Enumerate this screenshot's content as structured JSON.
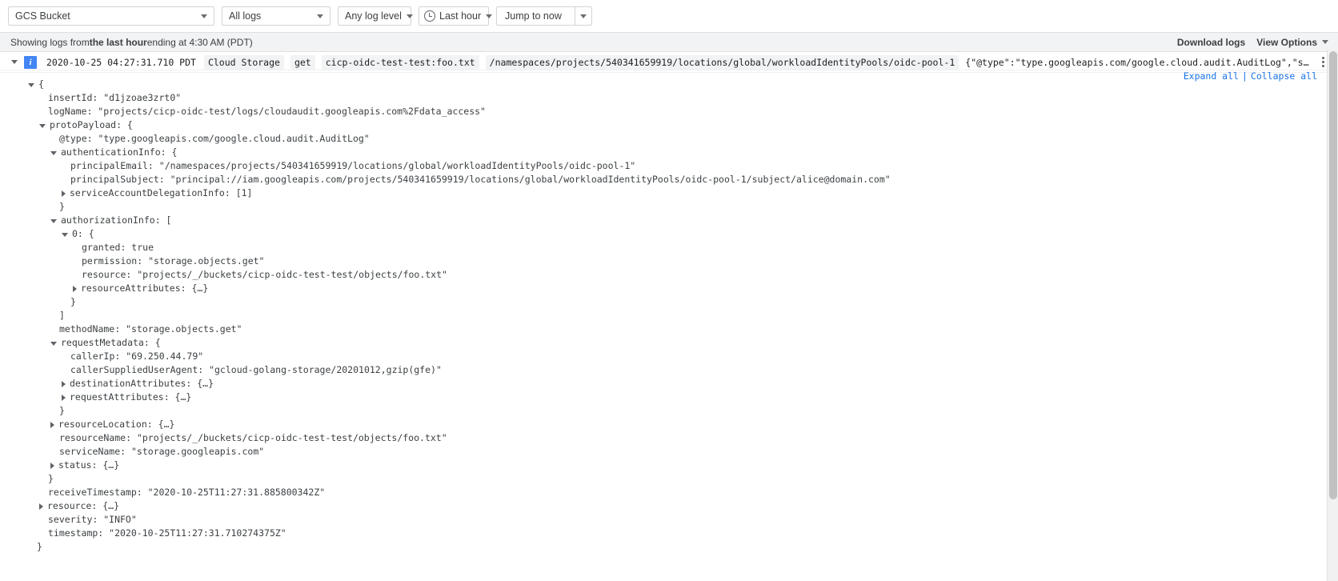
{
  "toolbar": {
    "resource_selector": {
      "label": "GCS Bucket",
      "icon": "chevron-down-icon"
    },
    "logs_selector": {
      "label": "All logs",
      "icon": "chevron-down-icon"
    },
    "level_selector": {
      "label": "Any log level",
      "icon": "chevron-down-icon"
    },
    "time_selector": {
      "label": "Last hour",
      "icon": "clock-icon",
      "caret": "chevron-down-icon"
    },
    "jump_button": {
      "label": "Jump to now",
      "caret": "chevron-down-icon"
    }
  },
  "statusbar": {
    "prefix": "Showing logs from ",
    "range": "the last hour",
    "suffix": " ending at 4:30 AM (PDT)",
    "download_logs": "Download logs",
    "view_options": "View Options"
  },
  "entry": {
    "severity_letter": "i",
    "severity": "INFO",
    "timestamp": "2020-10-25 04:27:31.710 PDT",
    "service_chip": "Cloud Storage",
    "method_chip": "get",
    "resource_chip": "cicp-oidc-test-test:foo.txt",
    "principal_chip": "/namespaces/projects/540341659919/locations/global/workloadIdentityPools/oidc-pool-1",
    "summary": "{\"@type\":\"type.googleapis.com/google.cloud.audit.AuditLog\",\"status\":{},\"authenticationInfo\":…",
    "kebab": "more-options-icon"
  },
  "tree_actions": {
    "expand_all": "Expand all",
    "separator": "|",
    "collapse_all": "Collapse all"
  },
  "colors": {
    "accent": "#1a73e8",
    "severity_info": "#4285f4",
    "chip_bg": "#f1f3f4",
    "statusbar_bg": "#f1f3f4"
  },
  "json_lines": [
    {
      "indent": 0,
      "arrow": "open",
      "text": "{"
    },
    {
      "indent": 1,
      "arrow": "none",
      "text": "insertId: \"d1jzoae3zrt0\""
    },
    {
      "indent": 1,
      "arrow": "none",
      "text": "logName: \"projects/cicp-oidc-test/logs/cloudaudit.googleapis.com%2Fdata_access\""
    },
    {
      "indent": 1,
      "arrow": "open",
      "text": "protoPayload: {"
    },
    {
      "indent": 2,
      "arrow": "none",
      "text": "@type: \"type.googleapis.com/google.cloud.audit.AuditLog\""
    },
    {
      "indent": 2,
      "arrow": "open",
      "text": "authenticationInfo: {"
    },
    {
      "indent": 3,
      "arrow": "none",
      "text": "principalEmail: \"/namespaces/projects/540341659919/locations/global/workloadIdentityPools/oidc-pool-1\""
    },
    {
      "indent": 3,
      "arrow": "none",
      "text": "principalSubject: \"principal://iam.googleapis.com/projects/540341659919/locations/global/workloadIdentityPools/oidc-pool-1/subject/alice@domain.com\""
    },
    {
      "indent": 3,
      "arrow": "closed",
      "text": "serviceAccountDelegationInfo: [1]"
    },
    {
      "indent": 2,
      "arrow": "none",
      "text": "}"
    },
    {
      "indent": 2,
      "arrow": "open",
      "text": "authorizationInfo: ["
    },
    {
      "indent": 3,
      "arrow": "open",
      "text": "0: {"
    },
    {
      "indent": 4,
      "arrow": "none",
      "text": "granted: true"
    },
    {
      "indent": 4,
      "arrow": "none",
      "text": "permission: \"storage.objects.get\""
    },
    {
      "indent": 4,
      "arrow": "none",
      "text": "resource: \"projects/_/buckets/cicp-oidc-test-test/objects/foo.txt\""
    },
    {
      "indent": 4,
      "arrow": "closed",
      "text": "resourceAttributes: {…}"
    },
    {
      "indent": 3,
      "arrow": "none",
      "text": "}"
    },
    {
      "indent": 2,
      "arrow": "none",
      "text": "]"
    },
    {
      "indent": 2,
      "arrow": "none",
      "text": "methodName: \"storage.objects.get\""
    },
    {
      "indent": 2,
      "arrow": "open",
      "text": "requestMetadata: {"
    },
    {
      "indent": 3,
      "arrow": "none",
      "text": "callerIp: \"69.250.44.79\""
    },
    {
      "indent": 3,
      "arrow": "none",
      "text": "callerSuppliedUserAgent: \"gcloud-golang-storage/20201012,gzip(gfe)\""
    },
    {
      "indent": 3,
      "arrow": "closed",
      "text": "destinationAttributes: {…}"
    },
    {
      "indent": 3,
      "arrow": "closed",
      "text": "requestAttributes: {…}"
    },
    {
      "indent": 2,
      "arrow": "none",
      "text": "}"
    },
    {
      "indent": 2,
      "arrow": "closed",
      "text": "resourceLocation: {…}"
    },
    {
      "indent": 2,
      "arrow": "none",
      "text": "resourceName: \"projects/_/buckets/cicp-oidc-test-test/objects/foo.txt\""
    },
    {
      "indent": 2,
      "arrow": "none",
      "text": "serviceName: \"storage.googleapis.com\""
    },
    {
      "indent": 2,
      "arrow": "closed",
      "text": "status: {…}"
    },
    {
      "indent": 1,
      "arrow": "none",
      "text": "}"
    },
    {
      "indent": 1,
      "arrow": "none",
      "text": "receiveTimestamp: \"2020-10-25T11:27:31.885800342Z\""
    },
    {
      "indent": 1,
      "arrow": "closed",
      "text": "resource: {…}"
    },
    {
      "indent": 1,
      "arrow": "none",
      "text": "severity: \"INFO\""
    },
    {
      "indent": 1,
      "arrow": "none",
      "text": "timestamp: \"2020-10-25T11:27:31.710274375Z\""
    },
    {
      "indent": 0,
      "arrow": "none",
      "text": "}"
    }
  ]
}
